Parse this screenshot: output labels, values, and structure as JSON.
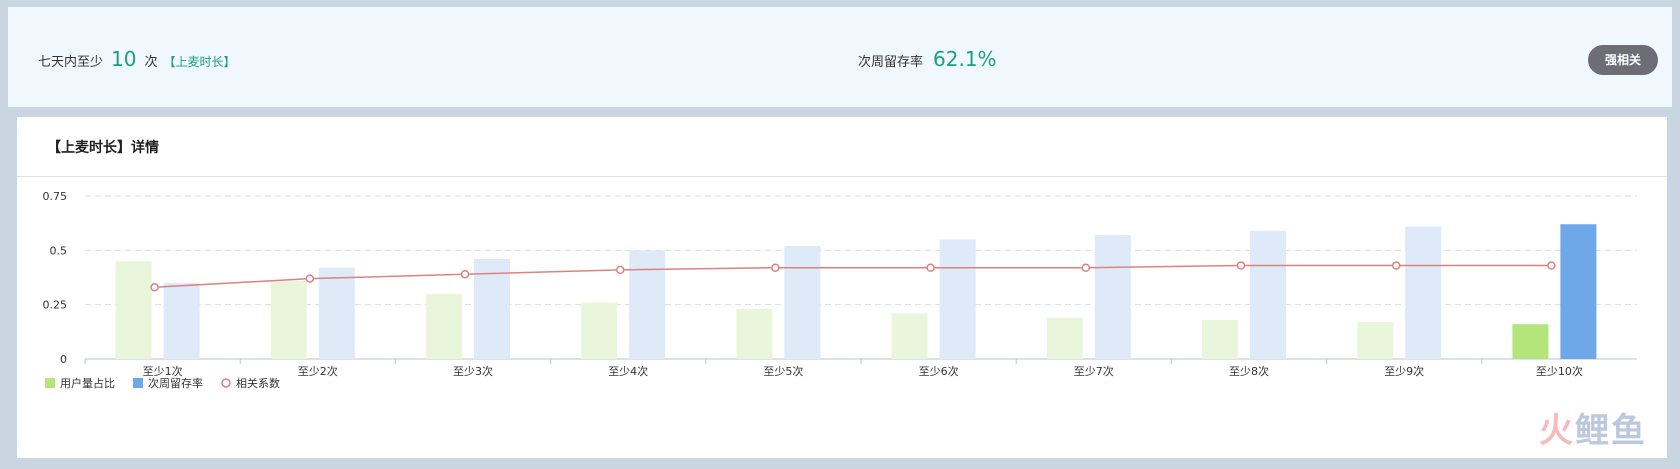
{
  "top": {
    "left_prefix": "七天内至少",
    "left_count": "10",
    "left_unit": "次",
    "left_tag": "【上麦时长】",
    "mid_label": "次周留存率",
    "mid_value": "62.1%",
    "button_label": "强相关"
  },
  "detail": {
    "title": "【上麦时长】详情"
  },
  "watermark": [
    "火",
    "鲤",
    "鱼"
  ],
  "chart_data": {
    "type": "bar",
    "categories": [
      "至少1次",
      "至少2次",
      "至少3次",
      "至少4次",
      "至少5次",
      "至少6次",
      "至少7次",
      "至少8次",
      "至少9次",
      "至少10次"
    ],
    "ylim": [
      0,
      0.75
    ],
    "yticks": [
      0,
      0.25,
      0.5,
      0.75
    ],
    "ytick_labels": [
      "0",
      "0.25",
      "0.5",
      "0.75"
    ],
    "grid": true,
    "legend_position": "bottom-left",
    "highlight_index": 9,
    "series": [
      {
        "name": "用户量占比",
        "type": "bar",
        "color": "#b3e57a",
        "faded_color": "#eaf6db",
        "values": [
          0.45,
          0.36,
          0.3,
          0.26,
          0.23,
          0.21,
          0.19,
          0.18,
          0.17,
          0.16
        ]
      },
      {
        "name": "次周留存率",
        "type": "bar",
        "color": "#6fa8e8",
        "faded_color": "#deeaf8",
        "values": [
          0.35,
          0.42,
          0.46,
          0.5,
          0.52,
          0.55,
          0.57,
          0.59,
          0.61,
          0.62
        ]
      },
      {
        "name": "相关系数",
        "type": "line",
        "color": "#e08080",
        "values": [
          0.33,
          0.37,
          0.39,
          0.41,
          0.42,
          0.42,
          0.42,
          0.43,
          0.43,
          0.43
        ]
      }
    ]
  }
}
